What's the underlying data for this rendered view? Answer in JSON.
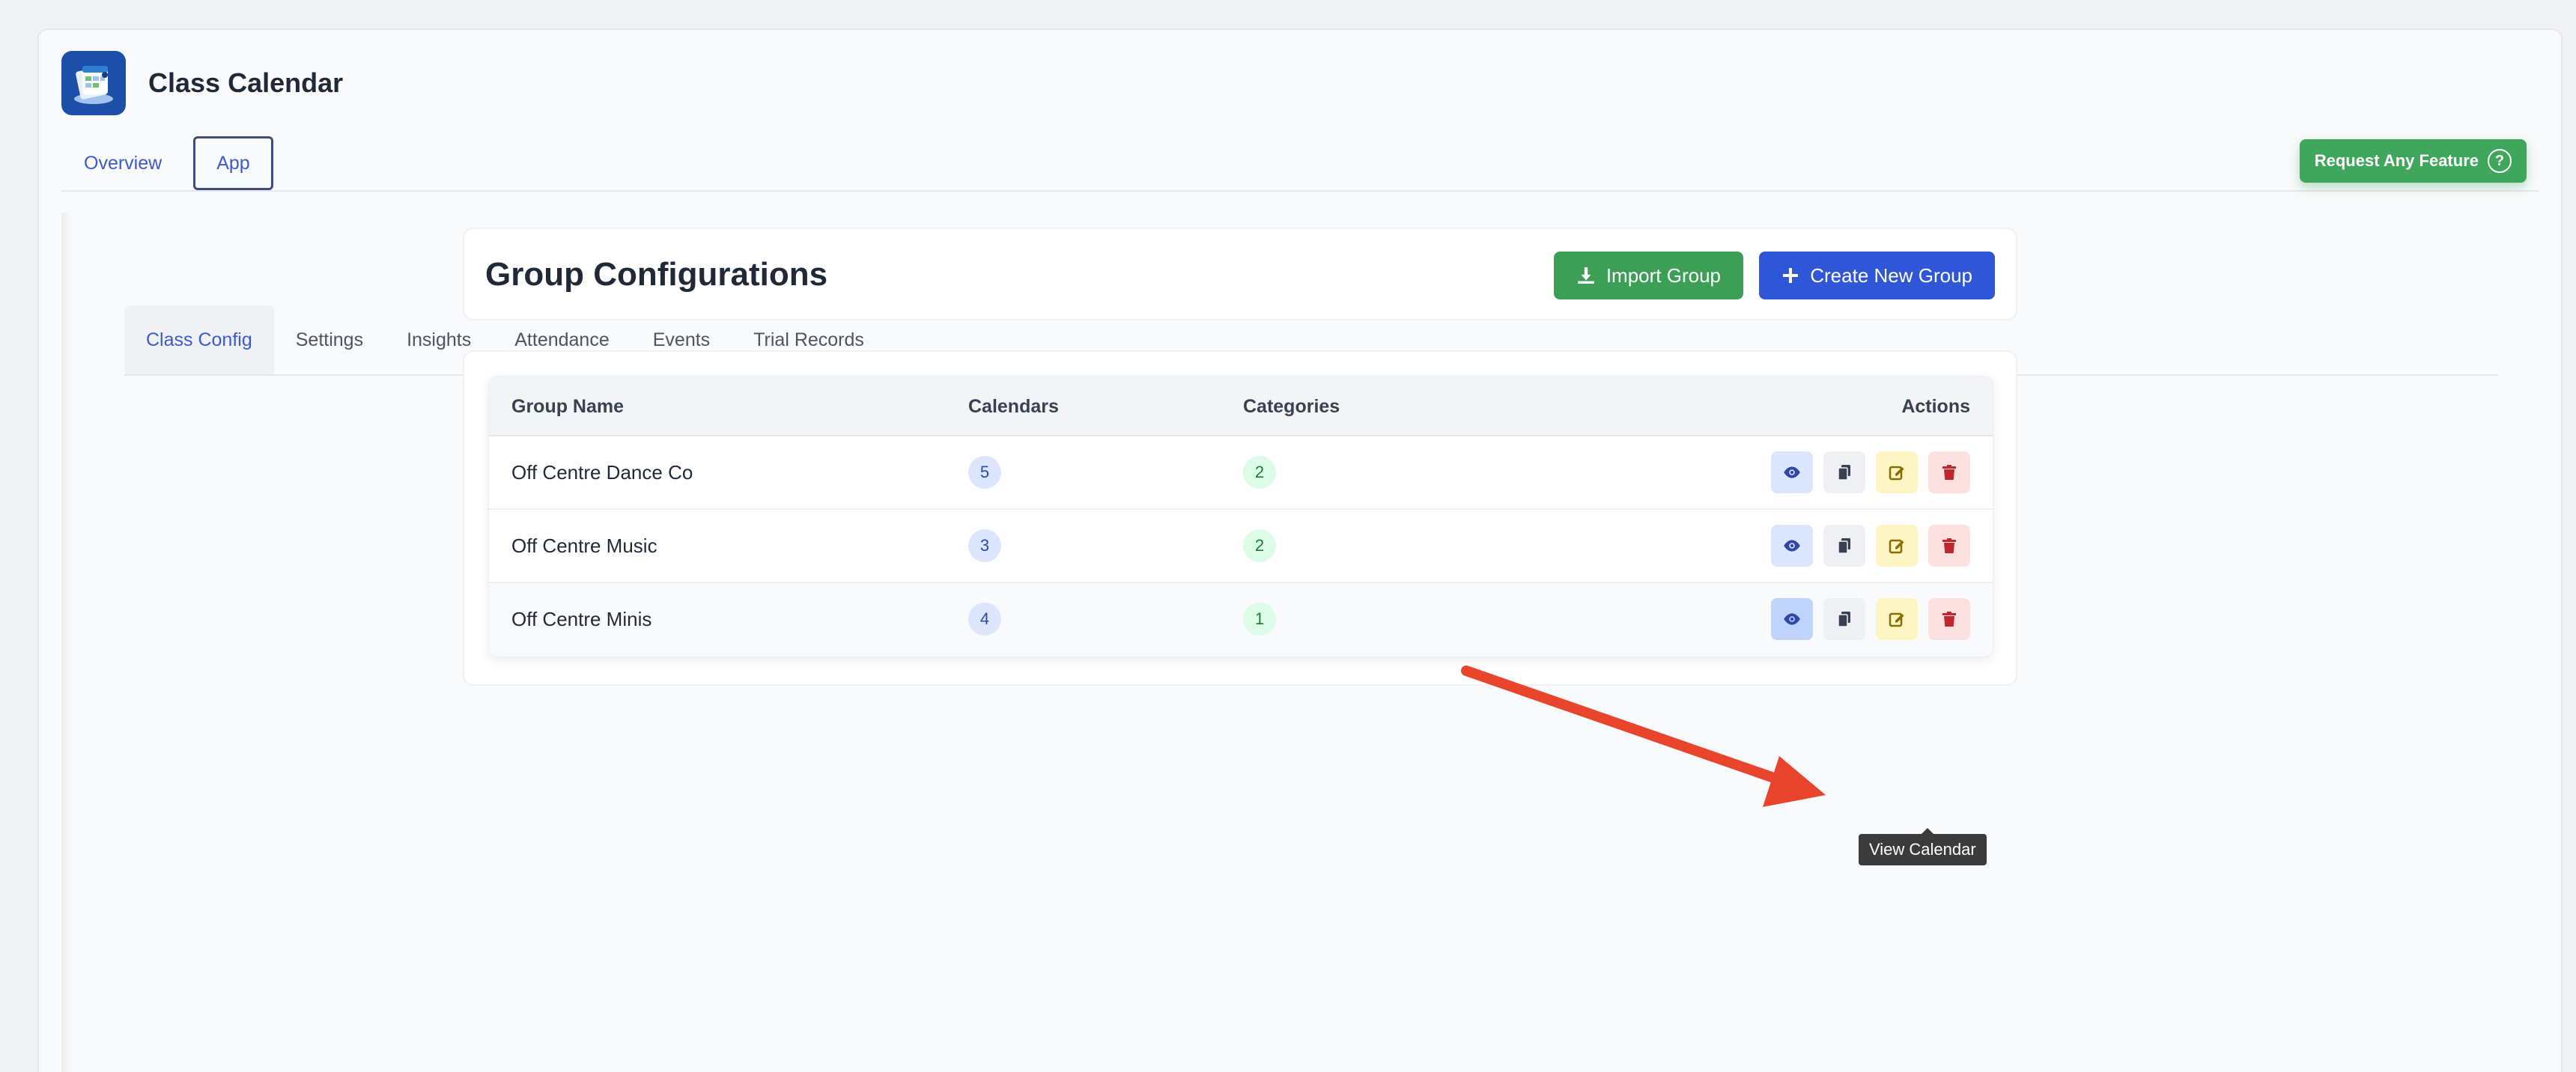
{
  "app": {
    "title": "Class Calendar",
    "tabs": [
      {
        "label": "Overview",
        "active": false
      },
      {
        "label": "App",
        "active": true
      }
    ],
    "feature_button": "Request Any Feature",
    "feature_button_icon": "?"
  },
  "subtabs": [
    {
      "label": "Class Config",
      "active": true
    },
    {
      "label": "Settings",
      "active": false
    },
    {
      "label": "Insights",
      "active": false
    },
    {
      "label": "Attendance",
      "active": false
    },
    {
      "label": "Events",
      "active": false
    },
    {
      "label": "Trial Records",
      "active": false
    }
  ],
  "header": {
    "title": "Group Configurations",
    "import_label": "Import Group",
    "create_label": "Create New Group"
  },
  "table": {
    "columns": {
      "name": "Group Name",
      "calendars": "Calendars",
      "categories": "Categories",
      "actions": "Actions"
    },
    "rows": [
      {
        "name": "Off Centre Dance Co",
        "calendars": "5",
        "categories": "2"
      },
      {
        "name": "Off Centre Music",
        "calendars": "3",
        "categories": "2"
      },
      {
        "name": "Off Centre Minis",
        "calendars": "4",
        "categories": "1"
      }
    ]
  },
  "tooltip": "View Calendar",
  "colors": {
    "primary_blue": "#3056d8",
    "green": "#3d9f56",
    "arrow_red": "#e8452c",
    "logo_blue": "#1d4fa8"
  },
  "icons": [
    "app-logo-icon",
    "download-icon",
    "plus-icon",
    "eye-icon",
    "copy-icon",
    "edit-icon",
    "trash-icon",
    "question-icon"
  ]
}
